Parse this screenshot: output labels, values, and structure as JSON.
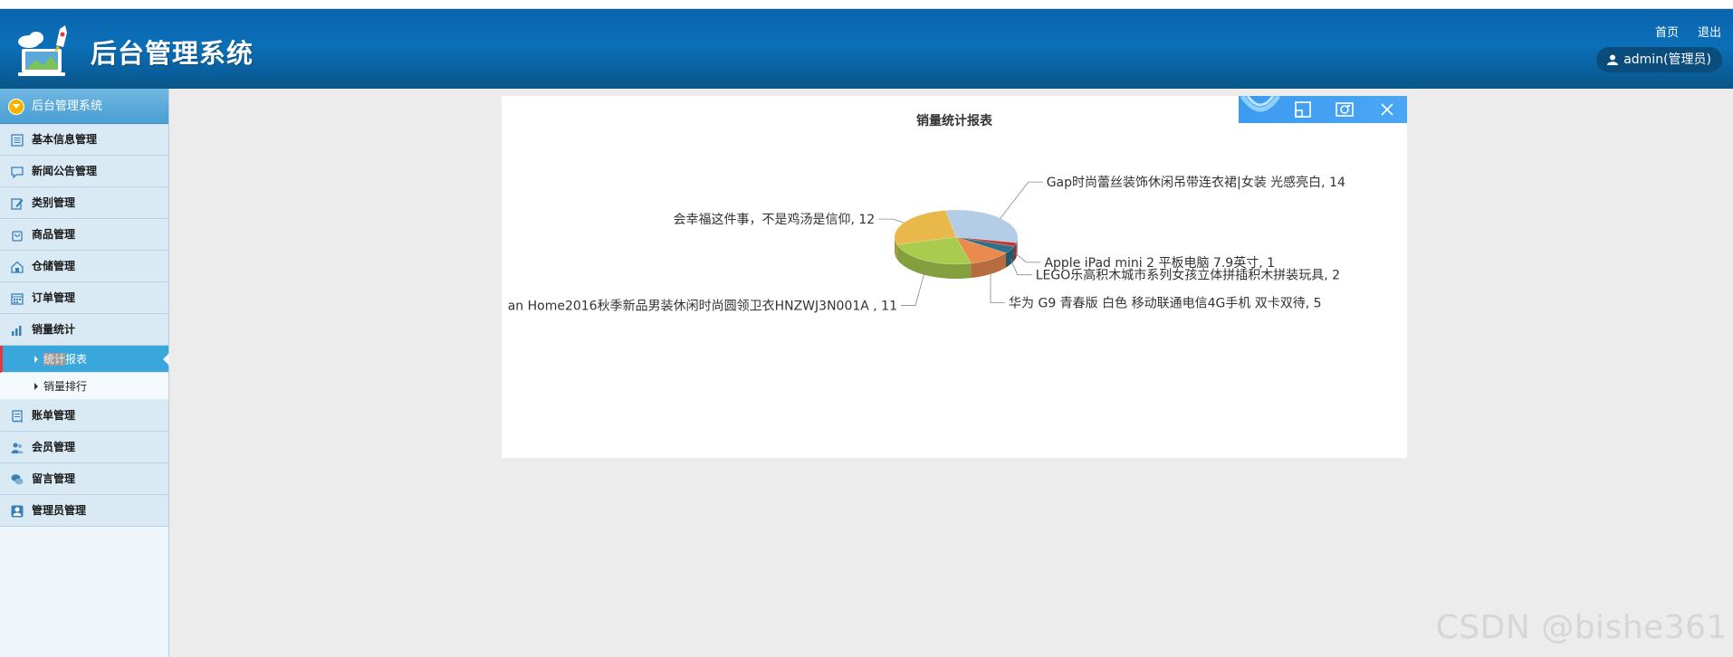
{
  "header": {
    "title": "后台管理系统",
    "home_link": "首页",
    "logout_link": "退出",
    "user": "admin(管理员)"
  },
  "sidebar": {
    "head": "后台管理系统",
    "items": [
      {
        "label": "基本信息管理",
        "icon": "list-icon"
      },
      {
        "label": "新闻公告管理",
        "icon": "chat-icon"
      },
      {
        "label": "类别管理",
        "icon": "edit-icon"
      },
      {
        "label": "商品管理",
        "icon": "bag-icon"
      },
      {
        "label": "仓储管理",
        "icon": "warehouse-icon"
      },
      {
        "label": "订单管理",
        "icon": "calendar-icon"
      },
      {
        "label": "销量统计",
        "icon": "bar-chart-icon"
      },
      {
        "label": "账单管理",
        "icon": "bill-icon"
      },
      {
        "label": "会员管理",
        "icon": "users-icon"
      },
      {
        "label": "留言管理",
        "icon": "comments-icon"
      },
      {
        "label": "管理员管理",
        "icon": "admin-icon"
      }
    ],
    "sub_items": [
      {
        "label_a": "统计",
        "label_b": "报表"
      },
      {
        "label": "销量排行"
      }
    ]
  },
  "chart_data": {
    "type": "pie",
    "title": "销量统计报表",
    "slices": [
      {
        "label": "Gap时尚蕾丝装饰休闲吊带连衣裙|女装 光感亮白, 14",
        "value": 14,
        "color": "#b3cde6"
      },
      {
        "label": "Apple iPad mini 2 平板电脑 7.9英寸, 1",
        "value": 1,
        "color": "#c23531"
      },
      {
        "label": "LEGO乐高积木城市系列女孩立体拼插积木拼装玩具, 2",
        "value": 2,
        "color": "#2f6f8a"
      },
      {
        "label": "华为 G9 青春版 白色 移动联通电信4G手机 双卡双待, 5",
        "value": 5,
        "color": "#ea8a4e"
      },
      {
        "label": "an Home2016秋季新品男装休闲时尚圆领卫衣HNZWJ3N001A , 11",
        "value": 11,
        "color": "#a9cc4e"
      },
      {
        "label": "会幸福这件事，不是鸡汤是信仰, 12",
        "value": 12,
        "color": "#e8b84b"
      }
    ]
  },
  "watermark": "CSDN @bishe361"
}
